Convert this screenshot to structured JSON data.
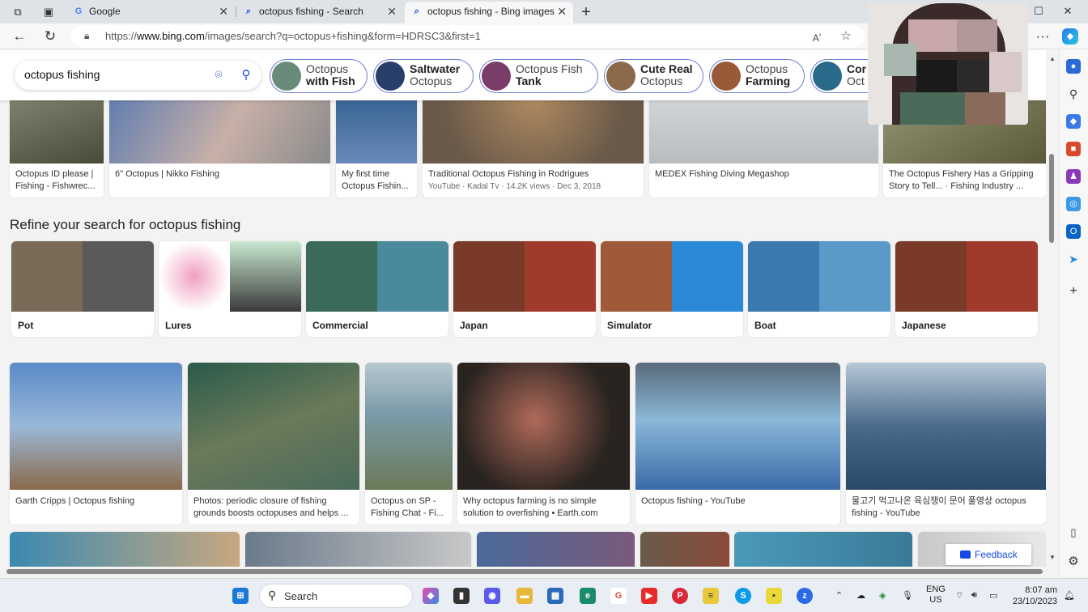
{
  "tabs": [
    {
      "title": "Google",
      "fav": "G",
      "fav_color": "#4285f4"
    },
    {
      "title": "octopus fishing - Search",
      "fav": "⌕",
      "fav_color": "#174ae4"
    },
    {
      "title": "octopus fishing - Bing images",
      "fav": "⌕",
      "fav_color": "#174ae4"
    }
  ],
  "new_tab": "+",
  "address": {
    "prefix": "https://",
    "host": "www.bing.com",
    "path": "/images/search?q=octopus+fishing&form=HDRSC3&first=1"
  },
  "search": {
    "query": "octopus fishing"
  },
  "chips": [
    {
      "line1": "Octopus",
      "line2": "with Fish",
      "bold_line": 2,
      "color": "#6b8b7a"
    },
    {
      "line1": "Saltwater",
      "line2": "Octopus",
      "bold_line": 1,
      "color": "#2a3e6a"
    },
    {
      "line1": "Octopus Fish",
      "line2": "Tank",
      "bold_line": 2,
      "color": "#7a3d6a"
    },
    {
      "line1": "Cute Real",
      "line2": "Octopus",
      "bold_line": 1,
      "color": "#8a6a4a"
    },
    {
      "line1": "Octopus",
      "line2": "Farming",
      "bold_line": 2,
      "color": "#9a5a3a"
    },
    {
      "line1": "Cor",
      "line2": "Oct",
      "bold_line": 1,
      "color": "#2a6a8a"
    }
  ],
  "top_row": [
    {
      "caption": "Octopus ID please | Fishing - Fishwrec...",
      "meta": "",
      "color": "#6a6a5a"
    },
    {
      "caption": "6\" Octopus | Nikko Fishing",
      "meta": "",
      "color": "#7a8aa0"
    },
    {
      "caption": "My first time Octopus Fishin...",
      "meta": "",
      "color": "#3a5a8a"
    },
    {
      "caption": "Traditional Octopus Fishing in Rodrigues",
      "meta": "YouTube · Kadal Tv · 14.2K views · Dec 3, 2018",
      "color": "#8a7a5a"
    },
    {
      "caption": "MEDEX Fishing Diving Megashop",
      "meta": "",
      "color": "#c0c4c8"
    },
    {
      "caption": "The Octopus Fishery Has a Gripping Story to Tell... · Fishing Industry ...",
      "meta": "",
      "color": "#6a6a4a"
    }
  ],
  "refine": {
    "heading": "Refine your search for octopus fishing",
    "items": [
      {
        "label": "Pot",
        "c1": "#7a6a58",
        "c2": "#5a5a58"
      },
      {
        "label": "Lures",
        "c1": "#e8c0d8",
        "c2": "#6aa8a0"
      },
      {
        "label": "Commercial",
        "c1": "#3a6a5a",
        "c2": "#4a8a9a"
      },
      {
        "label": "Japan",
        "c1": "#7a3a2a",
        "c2": "#a03a2a"
      },
      {
        "label": "Simulator",
        "c1": "#a05a3a",
        "c2": "#2a8ad8"
      },
      {
        "label": "Boat",
        "c1": "#3a7ab0",
        "c2": "#5a9ac8"
      },
      {
        "label": "Japanese",
        "c1": "#7a3a2a",
        "c2": "#a03a2a"
      }
    ]
  },
  "bottom_row": [
    {
      "caption": "Garth Cripps | Octopus fishing",
      "color": "#4a7ab8"
    },
    {
      "caption": "Photos: periodic closure of fishing grounds boosts octopuses and helps ...",
      "color": "#4a6a4a"
    },
    {
      "caption": "Octopus on SP - Fishing Chat - Fi...",
      "color": "#6a8a9a"
    },
    {
      "caption": "Why octopus farming is no simple solution to overfishing • Earth.com",
      "color": "#5a3a3a"
    },
    {
      "caption": "Octopus fishing - YouTube",
      "color": "#4a6a8a"
    },
    {
      "caption": "물고기 먹고나온 육심쟁이 문어 풀영상 octopus fishing - YouTube",
      "color": "#5a7a9a"
    }
  ],
  "feedback": "Feedback",
  "taskbar": {
    "search": "Search",
    "lang1": "ENG",
    "lang2": "US",
    "time": "8:07 am",
    "date": "23/10/2023"
  }
}
